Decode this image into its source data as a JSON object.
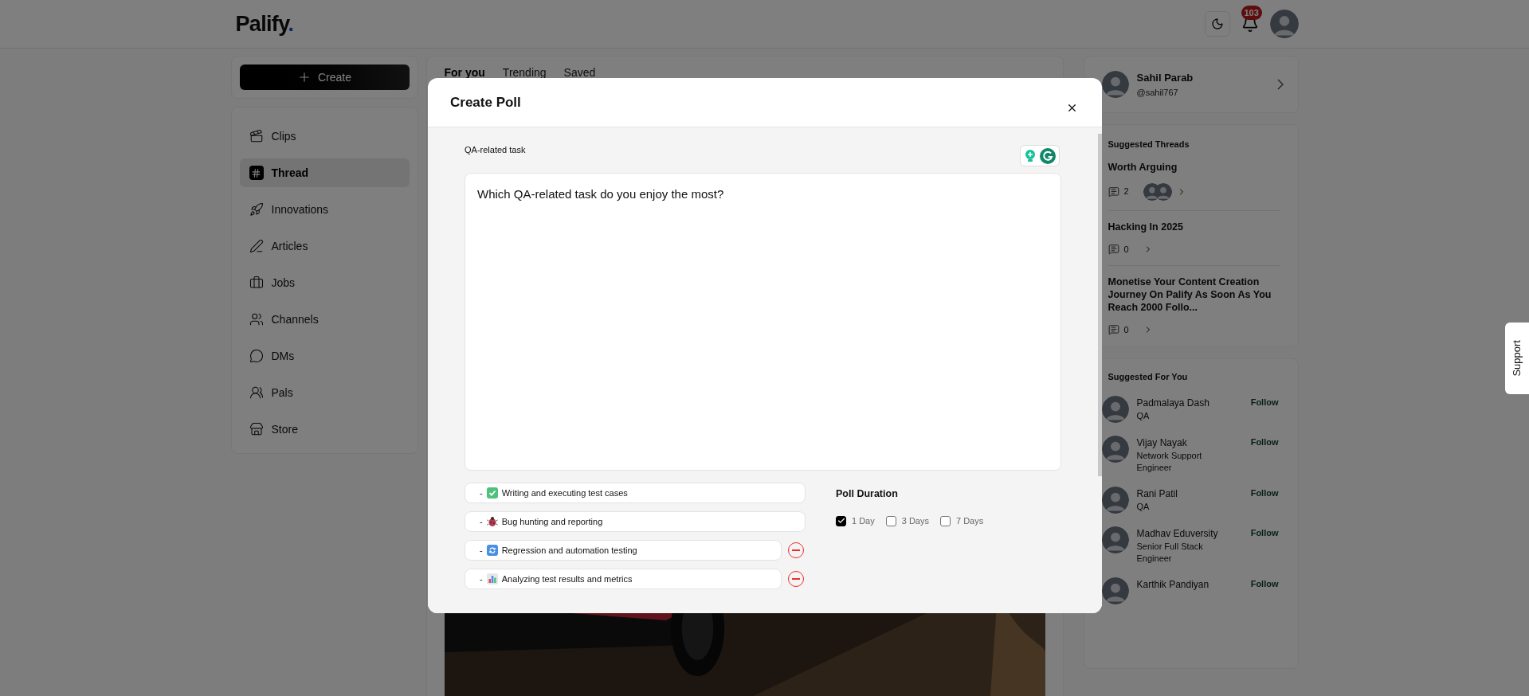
{
  "header": {
    "logo": "Palify",
    "logo_dot": ".",
    "notification_count": "103"
  },
  "sidebar": {
    "create_label": "Create",
    "items": [
      {
        "label": "Clips",
        "selected": false
      },
      {
        "label": "Thread",
        "selected": true
      },
      {
        "label": "Innovations",
        "selected": false
      },
      {
        "label": "Articles",
        "selected": false
      },
      {
        "label": "Jobs",
        "selected": false
      },
      {
        "label": "Channels",
        "selected": false
      },
      {
        "label": "DMs",
        "selected": false
      },
      {
        "label": "Pals",
        "selected": false
      },
      {
        "label": "Store",
        "selected": false
      }
    ]
  },
  "feed": {
    "tabs": [
      {
        "label": "For you",
        "selected": true
      },
      {
        "label": "Trending",
        "selected": false
      },
      {
        "label": "Saved",
        "selected": false
      }
    ]
  },
  "profile": {
    "name": "Sahil Parab",
    "handle": "@sahil767"
  },
  "suggested_threads": {
    "title": "Suggested Threads",
    "threads": [
      {
        "title": "Worth Arguing",
        "comments": "2",
        "avatars_shown": true
      },
      {
        "title": "Hacking In 2025",
        "comments": "0",
        "avatars_shown": false
      },
      {
        "title": "Monetise Your Content Creation Journey On Palify As Soon As You Reach 2000 Follo...",
        "comments": "0",
        "avatars_shown": false
      }
    ]
  },
  "suggested_people": {
    "title": "Suggested For You",
    "people": [
      {
        "name": "Padmalaya Dash",
        "role": "QA",
        "action": "Follow"
      },
      {
        "name": "Vijay Nayak",
        "role": "Network Support Engineer",
        "action": "Follow"
      },
      {
        "name": "Rani Patil",
        "role": "QA",
        "action": "Follow"
      },
      {
        "name": "Madhav Eduversity",
        "role": "Senior Full Stack Engineer",
        "action": "Follow"
      },
      {
        "name": "Karthik Pandiyan",
        "action": "Follow"
      }
    ]
  },
  "modal": {
    "title": "Create Poll",
    "label": "QA-related task",
    "question": "Which QA-related task do you enjoy the most?",
    "options": [
      {
        "prefix": "-",
        "text": "Writing and executing test cases",
        "removable": false
      },
      {
        "prefix": "-",
        "text": "Bug hunting and reporting",
        "removable": false
      },
      {
        "prefix": "-",
        "text": "Regression and automation testing",
        "removable": true
      },
      {
        "prefix": "-",
        "text": "Analyzing test results and metrics",
        "removable": true
      }
    ],
    "duration": {
      "title": "Poll Duration",
      "choices": [
        {
          "label": "1 Day",
          "checked": true
        },
        {
          "label": "3 Days",
          "checked": false
        },
        {
          "label": "7 Days",
          "checked": false
        }
      ]
    }
  },
  "support": "Support"
}
